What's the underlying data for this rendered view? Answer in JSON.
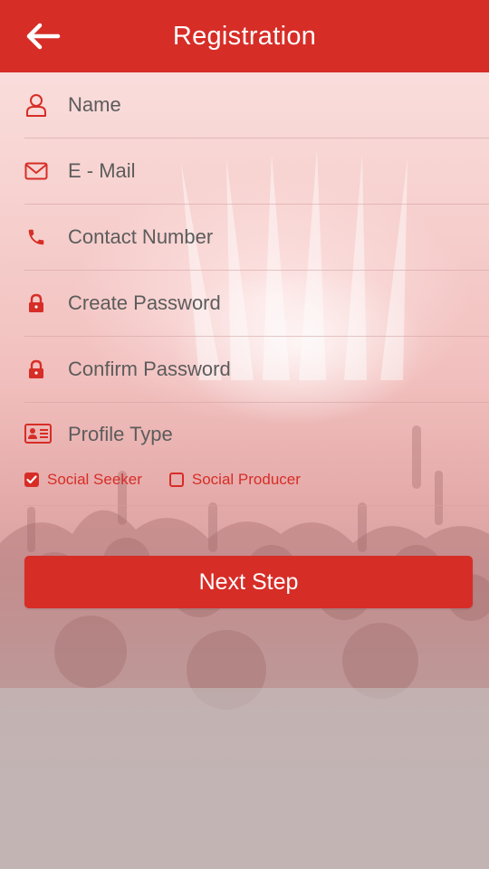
{
  "header": {
    "title": "Registration",
    "back_icon": "arrow-left-icon"
  },
  "form": {
    "fields": [
      {
        "id": "name",
        "placeholder": "Name",
        "value": "",
        "icon": "user-icon"
      },
      {
        "id": "email",
        "placeholder": "E - Mail",
        "value": "",
        "icon": "envelope-icon"
      },
      {
        "id": "contact",
        "placeholder": "Contact Number",
        "value": "",
        "icon": "phone-icon"
      },
      {
        "id": "create_password",
        "placeholder": "Create Password",
        "value": "",
        "icon": "lock-icon"
      },
      {
        "id": "confirm_password",
        "placeholder": "Confirm Password",
        "value": "",
        "icon": "lock-icon"
      }
    ],
    "profile_type": {
      "label": "Profile Type",
      "icon": "id-card-icon",
      "options": [
        {
          "label": "Social Seeker",
          "checked": true
        },
        {
          "label": "Social Producer",
          "checked": false
        }
      ]
    }
  },
  "next_button": {
    "label": "Next Step"
  },
  "colors": {
    "accent": "#d72d27",
    "text": "#5c5c5c",
    "background_bottom": "#c7c7c7"
  }
}
